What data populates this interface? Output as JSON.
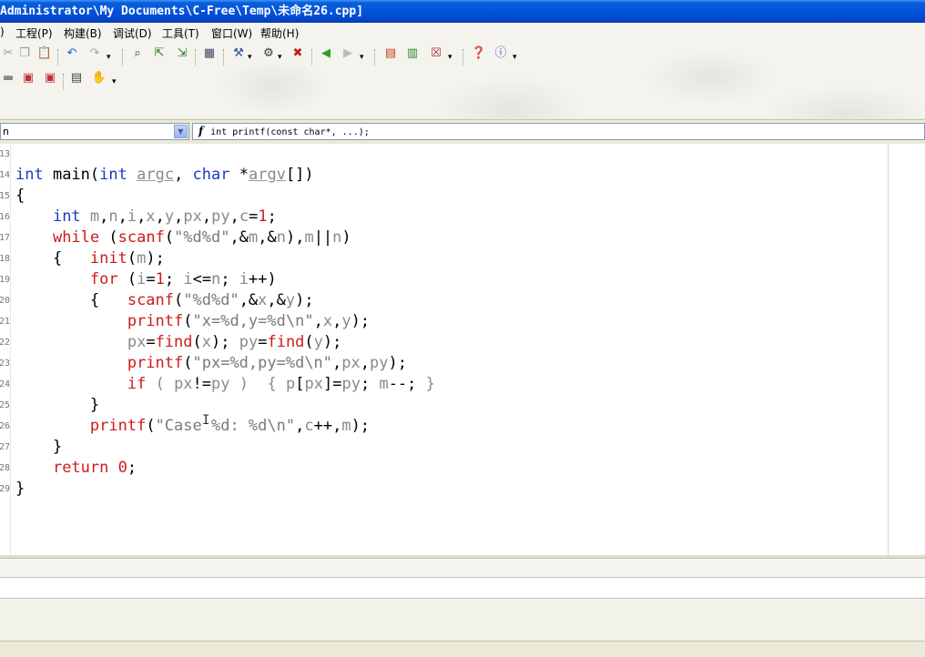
{
  "window": {
    "title": "Administrator\\My Documents\\C-Free\\Temp\\未命名26.cpp]"
  },
  "menu": [
    {
      "label": ")"
    },
    {
      "label": "工程(P)"
    },
    {
      "label": "构建(B)"
    },
    {
      "label": "调试(D)"
    },
    {
      "label": "工具(T)"
    },
    {
      "label": "窗口(W)"
    },
    {
      "label": "帮助(H)"
    }
  ],
  "combo": {
    "left_value": "n",
    "right_icon": "f",
    "right_value": "int printf(const char*, ...);"
  },
  "editor": {
    "line_numbers": [
      "13",
      "14",
      "15",
      "16",
      "17",
      "18",
      "19",
      "20",
      "21",
      "22",
      "23",
      "24",
      "25",
      "26",
      "27",
      "28",
      "29"
    ]
  },
  "icons": {
    "toolbar1": [
      "cut-icon",
      "copy-icon",
      "paste-icon",
      "undo-icon",
      "redo-icon",
      "find-icon",
      "find-prev-icon",
      "find-next-icon",
      "goto-icon",
      "compile-icon",
      "build-icon",
      "stop-icon",
      "back-icon",
      "forward-icon",
      "bookmark-icon",
      "bookmark-next-icon",
      "close-file-icon",
      "help-icon",
      "info-icon"
    ],
    "toolbar2": [
      "minus-icon",
      "breakpoint-icon",
      "breakpoint-list-icon",
      "clipboard-icon",
      "hand-icon"
    ]
  },
  "colors": {
    "keyword_blue": "#1a3acb",
    "keyword_red": "#cc1b1b",
    "string_gray": "#7a7a7a",
    "titlebar_blue": "#0353e0"
  }
}
